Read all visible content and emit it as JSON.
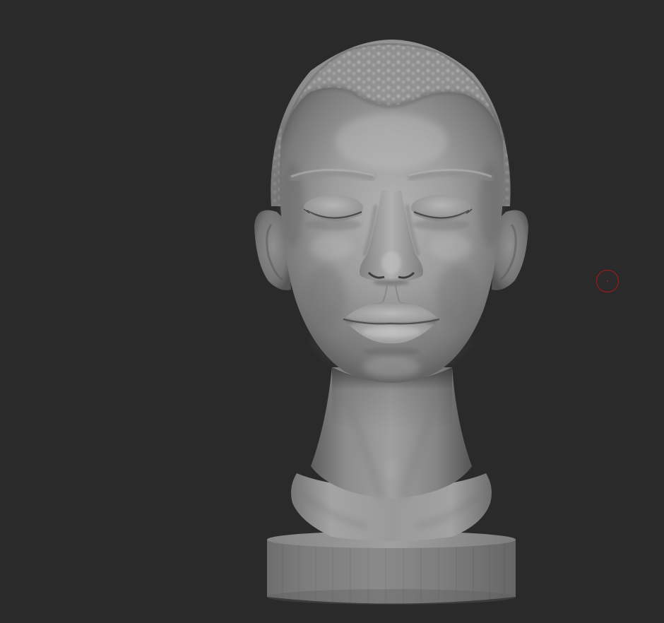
{
  "viewport": {
    "background": "#2a2a2a",
    "model": "head-bust-sculpt",
    "material_tone": "#9a9a9a"
  },
  "brush_cursor": {
    "color": "#b01818",
    "icon": "brush-circle-cursor"
  }
}
